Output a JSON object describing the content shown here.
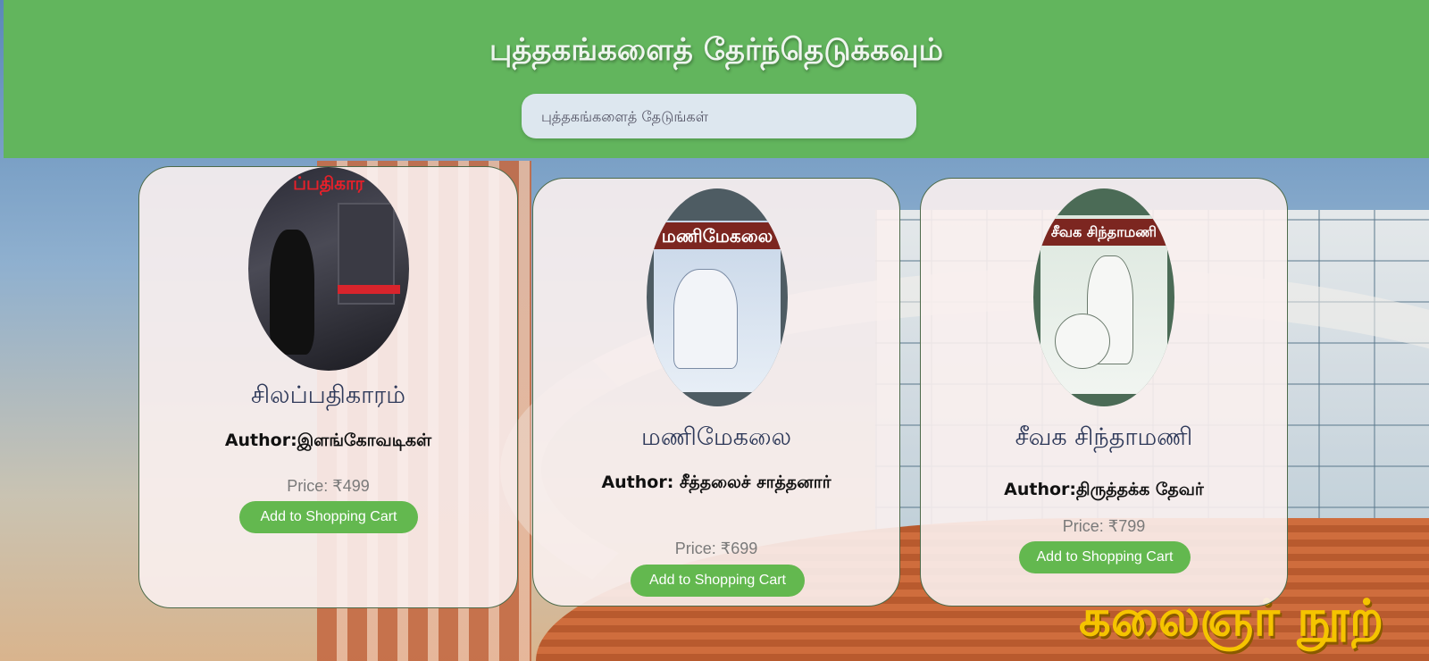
{
  "header": {
    "title": "புத்தகங்களைத் தேர்ந்தெடுக்கவும்",
    "search_placeholder": "புத்தகங்களைத் தேடுங்கள்"
  },
  "books": [
    {
      "title": "சிலப்பதிகாரம்",
      "author": "Author:இளங்கோவடிகள்",
      "price": "Price: ₹499",
      "button": "Add to Shopping Cart",
      "cover_text": "ப்பதிகார"
    },
    {
      "title": "மணிமேகலை",
      "author": "Author: சீத்தலைச் சாத்தனார்",
      "price": "Price: ₹699",
      "button": "Add to Shopping Cart",
      "cover_text": "மணிமேகலை"
    },
    {
      "title": "சீவக சிந்தாமணி",
      "author": "Author:திருத்தக்க தேவர்",
      "price": "Price: ₹799",
      "button": "Add to Shopping Cart",
      "cover_text": "சீவக சிந்தாமணி"
    }
  ],
  "background_sign": "கலைஞர் நூற்",
  "colors": {
    "header_bg": "#62b55d",
    "button_bg": "#63b84f",
    "card_bg": "#faf0ee"
  }
}
